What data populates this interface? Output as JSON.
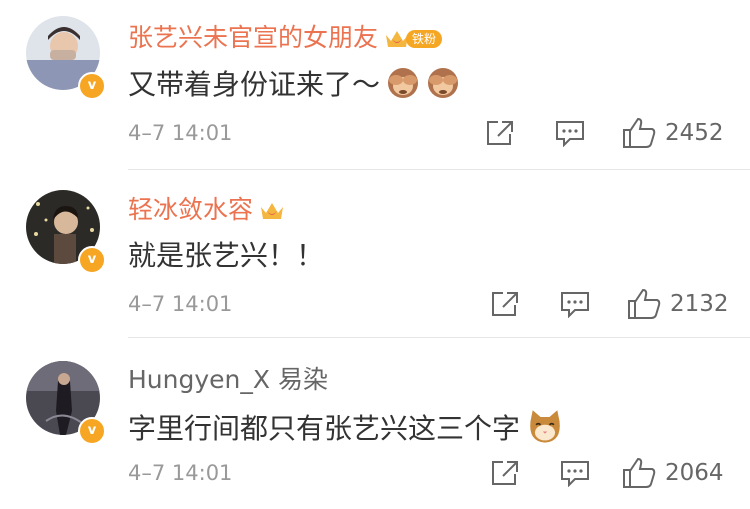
{
  "comments": [
    {
      "username": "张艺兴未官宣的女朋友",
      "fan_badge": "铁粉",
      "text": "又带着身份证来了～",
      "emojis": [
        "see-no-evil-monkey",
        "see-no-evil-monkey"
      ],
      "time": "4–7 14:01",
      "likes": "2452"
    },
    {
      "username": "轻冰敛水容",
      "text": "就是张艺兴！！",
      "time": "4–7 14:01",
      "likes": "2132"
    },
    {
      "username": "Hungyen_X 易染",
      "text": "字里行间都只有张艺兴这三个字",
      "emojis": [
        "cat-face"
      ],
      "time": "4–7 14:01",
      "likes": "2064"
    }
  ],
  "colors": {
    "username_vip": "#eb7350",
    "username_normal": "#666666",
    "text": "#333333",
    "meta": "#999999",
    "badge": "#f5a623"
  }
}
